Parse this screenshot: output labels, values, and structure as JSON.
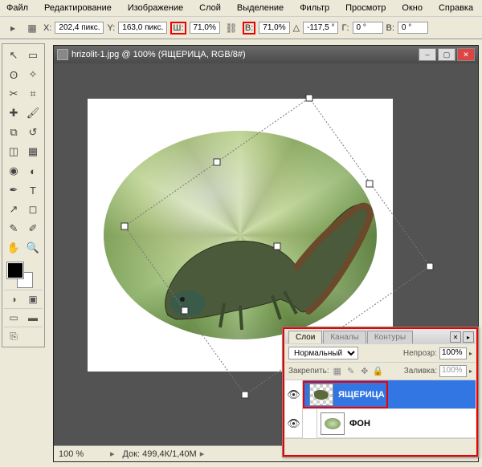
{
  "menu": [
    "Файл",
    "Редактирование",
    "Изображение",
    "Слой",
    "Выделение",
    "Фильтр",
    "Просмотр",
    "Окно",
    "Справка"
  ],
  "options": {
    "x_label": "X:",
    "x_val": "202,4 пикс.",
    "y_label": "Y:",
    "y_val": "163,0 пикс.",
    "w_label": "Ш:",
    "w_val": "71,0%",
    "h_label": "В:",
    "h_val": "71,0%",
    "angle_label": "△",
    "angle_val": "-117,5 °",
    "g_label": "Г:",
    "g_val": "0 °",
    "v_label": "В:",
    "v_val": "0 °"
  },
  "doc": {
    "title": "hrizolit-1.jpg @ 100% (ЯЩЕРИЦА, RGB/8#)",
    "zoom": "100 %",
    "docinfo": "Док: 499,4К/1,40М"
  },
  "layersPanel": {
    "tabs": [
      "Слои",
      "Каналы",
      "Контуры"
    ],
    "blend": "Нормальный",
    "opacity_label": "Непрозр:",
    "opacity": "100%",
    "lock_label": "Закрепить:",
    "fill_label": "Заливка:",
    "fill": "100%",
    "layers": [
      {
        "name": "ЯЩЕРИЦА",
        "selected": true,
        "checker": true
      },
      {
        "name": "ФОН",
        "selected": false,
        "checker": false
      }
    ]
  },
  "tools": [
    [
      "move",
      "marquee"
    ],
    [
      "lasso",
      "wand"
    ],
    [
      "crop",
      "slice"
    ],
    [
      "heal",
      "brush"
    ],
    [
      "stamp",
      "history"
    ],
    [
      "eraser",
      "gradient"
    ],
    [
      "blur",
      "dodge"
    ],
    [
      "pen",
      "type"
    ],
    [
      "path",
      "shape"
    ],
    [
      "notes",
      "eyedrop"
    ],
    [
      "hand",
      "zoom"
    ]
  ],
  "toolGlyphs": {
    "move": "↖",
    "marquee": "▭",
    "lasso": "ʘ",
    "wand": "✧",
    "crop": "✂",
    "slice": "⌗",
    "heal": "✚",
    "brush": "🖌",
    "stamp": "⧉",
    "history": "↺",
    "eraser": "◫",
    "gradient": "▦",
    "blur": "◉",
    "dodge": "◐",
    "pen": "✒",
    "type": "T",
    "path": "↗",
    "shape": "◻",
    "notes": "✎",
    "eyedrop": "✐",
    "hand": "✋",
    "zoom": "🔍"
  }
}
